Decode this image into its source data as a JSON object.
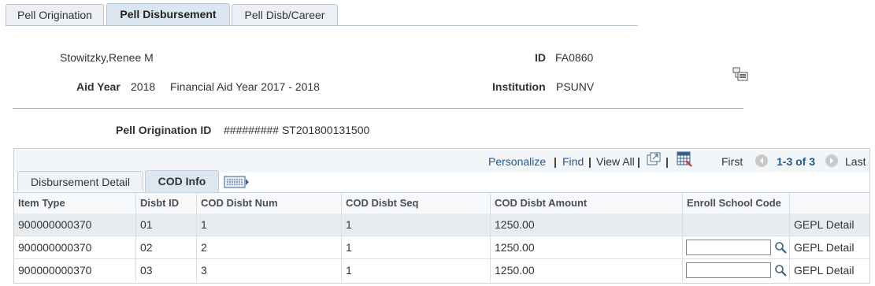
{
  "tabs": [
    "Pell Origination",
    "Pell Disbursement",
    "Pell Disb/Career"
  ],
  "student": {
    "name": "Stowitzky,Renee M",
    "id_label": "ID",
    "id_value": "FA0860"
  },
  "aid_year": {
    "label": "Aid Year",
    "value": "2018",
    "desc": "Financial Aid Year 2017 - 2018"
  },
  "institution": {
    "label": "Institution",
    "value": "PSUNV"
  },
  "pell_orig": {
    "label": "Pell Origination ID",
    "value": "######### ST201800131500"
  },
  "grid_nav": {
    "personalize": "Personalize",
    "find": "Find",
    "view_all": "View All",
    "first": "First",
    "range": "1-3 of 3",
    "last": "Last",
    "sep": "|"
  },
  "subtabs": [
    "Disbursement Detail",
    "COD Info"
  ],
  "columns": [
    "Item Type",
    "Disbt ID",
    "COD Disbt Num",
    "COD Disbt Seq",
    "COD Disbt Amount",
    "Enroll School Code"
  ],
  "rows": [
    {
      "item_type": "900000000370",
      "disbt_id": "01",
      "cod_num": "1",
      "cod_seq": "1",
      "cod_amt": "1250.00",
      "enroll_code": "",
      "detail": "GEPL Detail"
    },
    {
      "item_type": "900000000370",
      "disbt_id": "02",
      "cod_num": "2",
      "cod_seq": "1",
      "cod_amt": "1250.00",
      "enroll_code": "",
      "detail": "GEPL Detail"
    },
    {
      "item_type": "900000000370",
      "disbt_id": "03",
      "cod_num": "3",
      "cod_seq": "1",
      "cod_amt": "1250.00",
      "enroll_code": "",
      "detail": "GEPL Detail"
    }
  ],
  "colors": {
    "link": "#1d5a95",
    "tab_border": "#b9c6d6",
    "row_alt": "#e8ecef"
  }
}
